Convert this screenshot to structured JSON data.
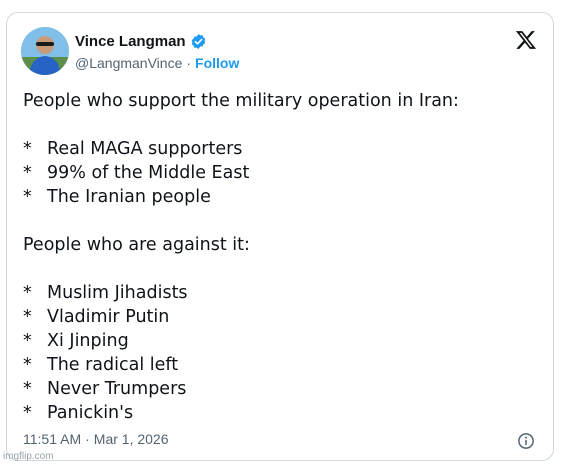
{
  "author": {
    "name": "Vince Langman",
    "handle": "@LangmanVince",
    "separator": "·",
    "follow_label": "Follow"
  },
  "tweet": {
    "intro": "People who support the military operation in Iran:",
    "support_items": [
      "Real MAGA supporters",
      "99% of the Middle East",
      "The Iranian people"
    ],
    "against_intro": "People who are against it:",
    "against_items": [
      "Muslim Jihadists",
      "Vladimir Putin",
      "Xi Jinping",
      "The radical left",
      "Never Trumpers",
      "Panickin's"
    ],
    "bullet": "*"
  },
  "footer": {
    "time": "11:51 AM",
    "separator": "·",
    "date": "Mar 1, 2026"
  },
  "watermark": "imgflip.com",
  "colors": {
    "link": "#1d9bf0",
    "muted": "#536471",
    "text": "#0f1419",
    "border": "#cfd9de"
  },
  "icons": [
    "verified-badge-icon",
    "x-logo-icon",
    "info-icon"
  ]
}
